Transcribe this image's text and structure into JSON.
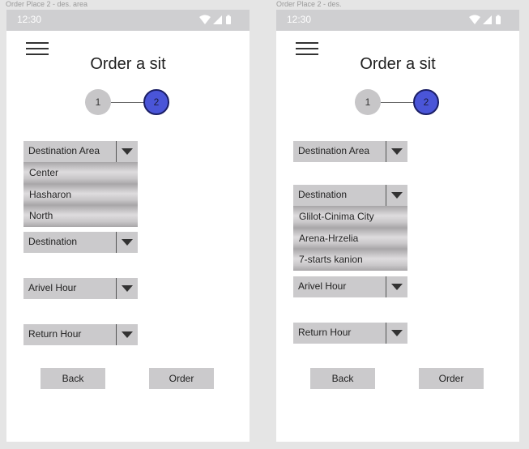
{
  "screens": [
    {
      "frame_label": "Order Place 2 - des. area",
      "status_time": "12:30",
      "title": "Order a sit",
      "steps": [
        "1",
        "2"
      ],
      "dropdowns": {
        "destination_area": "Destination Area",
        "destination": "Destination",
        "arrival_hour": "Arivel Hour",
        "return_hour": "Return Hour"
      },
      "open_options": [
        "Center",
        "Hasharon",
        "North"
      ],
      "buttons": {
        "back": "Back",
        "order": "Order"
      }
    },
    {
      "frame_label": "Order Place 2 - des.",
      "status_time": "12:30",
      "title": "Order a sit",
      "steps": [
        "1",
        "2"
      ],
      "dropdowns": {
        "destination_area": "Destination Area",
        "destination": "Destination",
        "arrival_hour": "Arivel Hour",
        "return_hour": "Return Hour"
      },
      "open_options": [
        "Glilot-Cinima City",
        "Arena-Hrzelia",
        "7-starts kanion"
      ],
      "buttons": {
        "back": "Back",
        "order": "Order"
      }
    }
  ],
  "colors": {
    "statusbar": "#cfcfd1",
    "control": "#cbcacc",
    "active_step": "#4a55d8",
    "inactive_step": "#c7c6c8"
  },
  "icons": [
    "menu-icon",
    "wifi-icon",
    "signal-icon",
    "battery-icon",
    "chevron-down-icon"
  ]
}
